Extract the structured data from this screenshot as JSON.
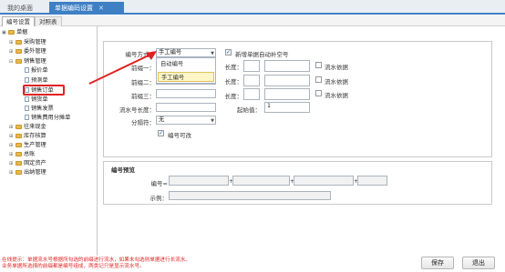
{
  "tabs": [
    {
      "label": "我的桌面"
    },
    {
      "label": "单据编码设置",
      "close": "✕"
    }
  ],
  "subtabs": [
    {
      "label": "编号设置"
    },
    {
      "label": "对照表"
    }
  ],
  "tree": {
    "items": [
      {
        "label": "单据",
        "toggle": "▣"
      },
      {
        "label": "采购管理",
        "toggle": "⊞"
      },
      {
        "label": "委外管理",
        "toggle": "⊞"
      },
      {
        "label": "销售管理",
        "toggle": "⊟"
      },
      {
        "label": "报价单"
      },
      {
        "label": "预测单"
      },
      {
        "label": "销售订单"
      },
      {
        "label": "销货单"
      },
      {
        "label": "销售发票"
      },
      {
        "label": "销售费用分摊单"
      },
      {
        "label": "往来现金",
        "toggle": "⊞"
      },
      {
        "label": "库存核算",
        "toggle": "⊞"
      },
      {
        "label": "生产管理",
        "toggle": "⊞"
      },
      {
        "label": "总账",
        "toggle": "⊞"
      },
      {
        "label": "固定资产",
        "toggle": "⊞"
      },
      {
        "label": "出纳管理",
        "toggle": "⊞"
      }
    ]
  },
  "form": {
    "method_label": "编号方式：",
    "method_value": "手工编号",
    "method_options": [
      "自动编号",
      "手工编号"
    ],
    "auto_fill_label": "新增单据自动补空号",
    "auto_fill_checked": "✓",
    "prefix1_label": "前缀一：",
    "prefix2_label": "前缀二：",
    "prefix3_label": "前缀三：",
    "length_label": "长度：",
    "serial_basis_label": "流水依据",
    "serial_len_label": "流水号长度：",
    "start_label": "起始值：",
    "start_value": "1",
    "sep_label": "分隔符：",
    "sep_value": "无",
    "editable_label": "编号可改",
    "editable_checked": "✓"
  },
  "preview": {
    "title": "编号预览",
    "number_label": "编号=",
    "plus": "+",
    "example_label": "示例："
  },
  "footer": {
    "tip_line1": "在线提示：单据流水号根据所勾选的前缀进行流水，如果未勾选则单据进行长流水。",
    "tip_line2": "业务单据所选择的前缀都是编号组成，两类记只是显示流水号。",
    "save_label": "保存",
    "exit_label": "退出"
  },
  "colors": {
    "accent": "#3f7fc4",
    "highlight_red": "#e02222"
  }
}
